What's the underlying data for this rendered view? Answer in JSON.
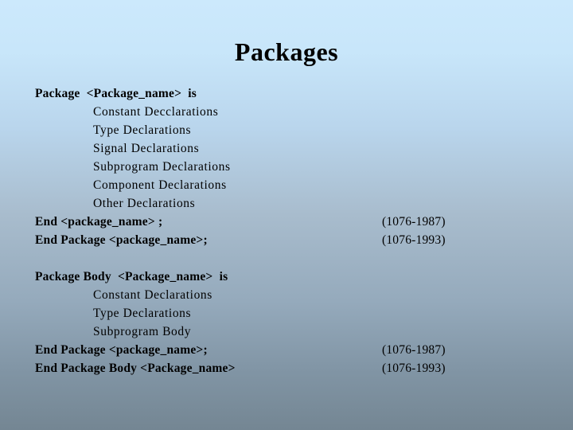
{
  "slide": {
    "title": "Packages",
    "background": {
      "top_color": "#cce9fc",
      "mid_color": "#a8bccd",
      "bottom_color": "#748693"
    },
    "text_color": "#000000",
    "blocks": [
      {
        "name": "package-declaration-block",
        "lines": [
          {
            "text": "Package  <Package_name>  is",
            "indent": 0,
            "bold": true,
            "ref": ""
          },
          {
            "text": "Constant Decclarations",
            "indent": 1,
            "bold": false,
            "ref": ""
          },
          {
            "text": "Type Declarations",
            "indent": 1,
            "bold": false,
            "ref": ""
          },
          {
            "text": "Signal Declarations",
            "indent": 1,
            "bold": false,
            "ref": ""
          },
          {
            "text": "Subprogram Declarations",
            "indent": 1,
            "bold": false,
            "ref": ""
          },
          {
            "text": "Component Declarations",
            "indent": 1,
            "bold": false,
            "ref": ""
          },
          {
            "text": "Other Declarations",
            "indent": 1,
            "bold": false,
            "ref": ""
          },
          {
            "text": "End <package_name> ;",
            "indent": 0,
            "bold": true,
            "ref": "(1076-1987)"
          },
          {
            "text": "End Package <package_name>;",
            "indent": 0,
            "bold": true,
            "ref": "(1076-1993)"
          }
        ]
      },
      {
        "name": "package-body-block",
        "lines": [
          {
            "text": "Package Body  <Package_name>  is",
            "indent": 0,
            "bold": true,
            "ref": ""
          },
          {
            "text": "Constant Declarations",
            "indent": 1,
            "bold": false,
            "ref": ""
          },
          {
            "text": "Type Declarations",
            "indent": 1,
            "bold": false,
            "ref": ""
          },
          {
            "text": "Subprogram Body",
            "indent": 1,
            "bold": false,
            "ref": ""
          },
          {
            "text": "End Package <package_name>;",
            "indent": 0,
            "bold": true,
            "ref": "(1076-1987)"
          },
          {
            "text": "End Package Body <Package_name>",
            "indent": 0,
            "bold": true,
            "ref": "(1076-1993)"
          }
        ]
      }
    ]
  }
}
